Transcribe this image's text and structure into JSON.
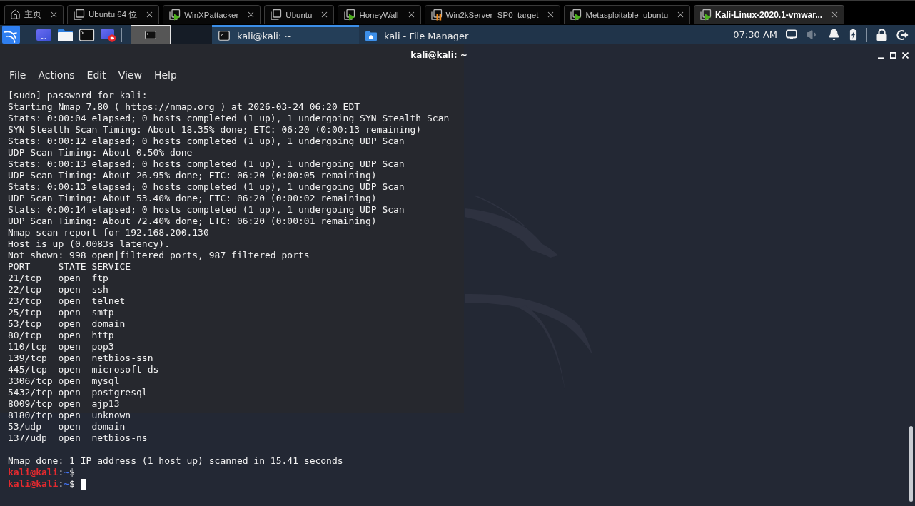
{
  "vm_tabs": [
    {
      "label": "主页",
      "kind": "home",
      "selected": false
    },
    {
      "label": "Ubuntu 64 位",
      "kind": "stopped",
      "selected": false
    },
    {
      "label": "WinXPattacker",
      "kind": "running",
      "selected": false
    },
    {
      "label": "Ubuntu",
      "kind": "stopped",
      "selected": false
    },
    {
      "label": "HoneyWall",
      "kind": "running",
      "selected": false
    },
    {
      "label": "Win2kServer_SP0_target",
      "kind": "paused",
      "selected": false
    },
    {
      "label": "Metasploitable_ubuntu",
      "kind": "running",
      "selected": false
    },
    {
      "label": "Kali-Linux-2020.1-vmwar...",
      "kind": "running",
      "selected": true
    }
  ],
  "panel": {
    "workspaces": [
      {
        "selected": true
      },
      {
        "selected": false
      }
    ],
    "windows": [
      {
        "title": "kali@kali: ~",
        "kind": "terminal",
        "selected": true
      },
      {
        "title": "kali - File Manager",
        "kind": "file_manager",
        "selected": false
      }
    ],
    "clock": "07:30 AM",
    "volume": {
      "disabled": true
    }
  },
  "terminal": {
    "title": "kali@kali: ~",
    "menu": [
      "File",
      "Actions",
      "Edit",
      "View",
      "Help"
    ],
    "output": [
      "[sudo] password for kali:",
      "Starting Nmap 7.80 ( https://nmap.org ) at 2026-03-24 06:20 EDT",
      "Stats: 0:00:04 elapsed; 0 hosts completed (1 up), 1 undergoing SYN Stealth Scan",
      "SYN Stealth Scan Timing: About 18.35% done; ETC: 06:20 (0:00:13 remaining)",
      "Stats: 0:00:12 elapsed; 0 hosts completed (1 up), 1 undergoing UDP Scan",
      "UDP Scan Timing: About 0.50% done",
      "Stats: 0:00:13 elapsed; 0 hosts completed (1 up), 1 undergoing UDP Scan",
      "UDP Scan Timing: About 26.95% done; ETC: 06:20 (0:00:05 remaining)",
      "Stats: 0:00:13 elapsed; 0 hosts completed (1 up), 1 undergoing UDP Scan",
      "UDP Scan Timing: About 53.40% done; ETC: 06:20 (0:00:02 remaining)",
      "Stats: 0:00:14 elapsed; 0 hosts completed (1 up), 1 undergoing UDP Scan",
      "UDP Scan Timing: About 72.40% done; ETC: 06:20 (0:00:01 remaining)",
      "Nmap scan report for 192.168.200.130",
      "Host is up (0.0083s latency).",
      "Not shown: 998 open|filtered ports, 987 filtered ports"
    ],
    "port_table": {
      "columns": [
        "PORT",
        "STATE",
        "SERVICE"
      ],
      "rows": [
        {
          "port": "21/tcp",
          "state": "open",
          "service": "ftp"
        },
        {
          "port": "22/tcp",
          "state": "open",
          "service": "ssh"
        },
        {
          "port": "23/tcp",
          "state": "open",
          "service": "telnet"
        },
        {
          "port": "25/tcp",
          "state": "open",
          "service": "smtp"
        },
        {
          "port": "53/tcp",
          "state": "open",
          "service": "domain"
        },
        {
          "port": "80/tcp",
          "state": "open",
          "service": "http"
        },
        {
          "port": "110/tcp",
          "state": "open",
          "service": "pop3"
        },
        {
          "port": "139/tcp",
          "state": "open",
          "service": "netbios-ssn"
        },
        {
          "port": "445/tcp",
          "state": "open",
          "service": "microsoft-ds"
        },
        {
          "port": "3306/tcp",
          "state": "open",
          "service": "mysql"
        },
        {
          "port": "5432/tcp",
          "state": "open",
          "service": "postgresql"
        },
        {
          "port": "8009/tcp",
          "state": "open",
          "service": "ajp13"
        },
        {
          "port": "8180/tcp",
          "state": "open",
          "service": "unknown"
        },
        {
          "port": "53/udp",
          "state": "open",
          "service": "domain"
        },
        {
          "port": "137/udp",
          "state": "open",
          "service": "netbios-ns"
        }
      ]
    },
    "summary": "Nmap done: 1 IP address (1 host up) scanned in 15.41 seconds",
    "prompts": [
      {
        "user": "kali@kali",
        "separator": ":",
        "path": "~",
        "symbol": "$",
        "cursor": false
      },
      {
        "user": "kali@kali",
        "separator": ":",
        "path": "~",
        "symbol": "$",
        "cursor": true
      }
    ]
  }
}
